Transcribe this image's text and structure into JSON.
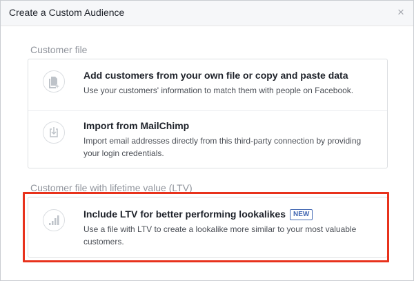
{
  "dialog": {
    "title": "Create a Custom Audience",
    "close_glyph": "×"
  },
  "sections": [
    {
      "title": "Customer file",
      "options": [
        {
          "title": "Add customers from your own file or copy and paste data",
          "description": "Use your customers' information to match them with people on Facebook.",
          "icon": "file-add-icon"
        },
        {
          "title": "Import from MailChimp",
          "description": "Import email addresses directly from this third-party connection by providing your login credentials.",
          "icon": "import-icon"
        }
      ]
    },
    {
      "title": "Customer file with lifetime value (LTV)",
      "options": [
        {
          "title": "Include LTV for better performing lookalikes",
          "badge": "NEW",
          "description": "Use a file with LTV to create a lookalike more similar to your most valuable customers.",
          "icon": "signal-bars-icon"
        }
      ]
    }
  ],
  "colors": {
    "highlight": "#e8321c",
    "badge": "#4267b2",
    "section_title": "#90949c"
  }
}
